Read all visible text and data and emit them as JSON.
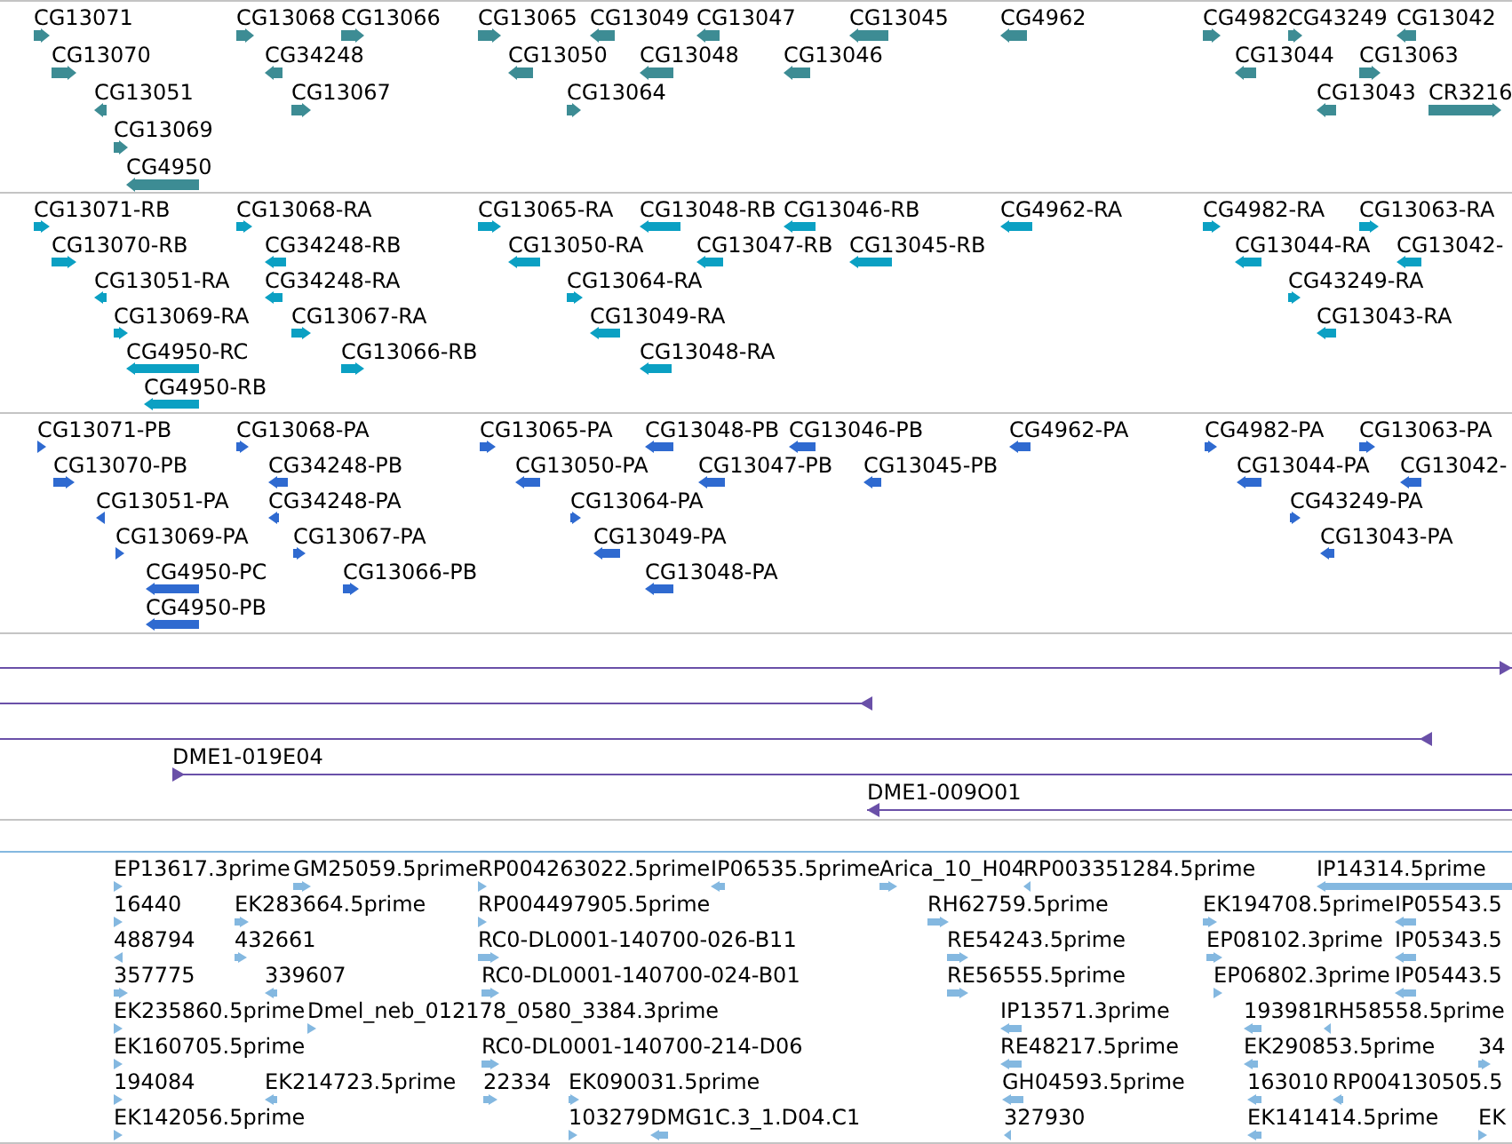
{
  "tracks": [
    {
      "kind": "gene",
      "features": [
        {
          "label": "CG13071",
          "reverse": false
        },
        {
          "label": "CG13068",
          "reverse": false
        },
        {
          "label": "CG13066",
          "reverse": false
        },
        {
          "label": "CG13065",
          "reverse": false
        },
        {
          "label": "CG13049",
          "reverse": true
        },
        {
          "label": "CG13047",
          "reverse": true
        },
        {
          "label": "CG13045",
          "reverse": true
        },
        {
          "label": "CG4962",
          "reverse": true
        },
        {
          "label": "CG4982",
          "reverse": false
        },
        {
          "label": "CG43249",
          "reverse": false
        },
        {
          "label": "CG13042",
          "reverse": true
        },
        {
          "label": "CG13070",
          "reverse": false
        },
        {
          "label": "CG34248",
          "reverse": true
        },
        {
          "label": "CG13050",
          "reverse": true
        },
        {
          "label": "CG13048",
          "reverse": true
        },
        {
          "label": "CG13046",
          "reverse": true
        },
        {
          "label": "CG13044",
          "reverse": true
        },
        {
          "label": "CG13063",
          "reverse": false
        },
        {
          "label": "CG13051",
          "reverse": true
        },
        {
          "label": "CG13067",
          "reverse": false
        },
        {
          "label": "CG13064",
          "reverse": false
        },
        {
          "label": "CG13043",
          "reverse": true
        },
        {
          "label": "CR3216",
          "reverse": false
        },
        {
          "label": "CG13069",
          "reverse": false
        },
        {
          "label": "CG4950",
          "reverse": true
        }
      ]
    },
    {
      "kind": "transcript",
      "features": [
        {
          "label": "CG13071-RB",
          "reverse": false
        },
        {
          "label": "CG13068-RA",
          "reverse": false
        },
        {
          "label": "CG13065-RA",
          "reverse": false
        },
        {
          "label": "CG13048-RB",
          "reverse": true
        },
        {
          "label": "CG13046-RB",
          "reverse": true
        },
        {
          "label": "CG4962-RA",
          "reverse": true
        },
        {
          "label": "CG4982-RA",
          "reverse": false
        },
        {
          "label": "CG13063-RA",
          "reverse": false
        },
        {
          "label": "CG13070-RB",
          "reverse": false
        },
        {
          "label": "CG34248-RB",
          "reverse": true
        },
        {
          "label": "CG13050-RA",
          "reverse": true
        },
        {
          "label": "CG13047-RB",
          "reverse": true
        },
        {
          "label": "CG13045-RB",
          "reverse": true
        },
        {
          "label": "CG13044-RA",
          "reverse": true
        },
        {
          "label": "CG13042-",
          "reverse": true
        },
        {
          "label": "CG13051-RA",
          "reverse": true
        },
        {
          "label": "CG34248-RA",
          "reverse": true
        },
        {
          "label": "CG13064-RA",
          "reverse": false
        },
        {
          "label": "CG43249-RA",
          "reverse": false
        },
        {
          "label": "CG13069-RA",
          "reverse": false
        },
        {
          "label": "CG13067-RA",
          "reverse": false
        },
        {
          "label": "CG13049-RA",
          "reverse": true
        },
        {
          "label": "CG13043-RA",
          "reverse": true
        },
        {
          "label": "CG4950-RC",
          "reverse": true
        },
        {
          "label": "CG13066-RB",
          "reverse": false
        },
        {
          "label": "CG13048-RA",
          "reverse": true
        },
        {
          "label": "CG4950-RB",
          "reverse": true
        }
      ]
    },
    {
      "kind": "protein",
      "features": [
        {
          "label": "CG13071-PB",
          "reverse": false
        },
        {
          "label": "CG13068-PA",
          "reverse": false
        },
        {
          "label": "CG13065-PA",
          "reverse": false
        },
        {
          "label": "CG13048-PB",
          "reverse": true
        },
        {
          "label": "CG13046-PB",
          "reverse": true
        },
        {
          "label": "CG4962-PA",
          "reverse": true
        },
        {
          "label": "CG4982-PA",
          "reverse": false
        },
        {
          "label": "CG13063-PA",
          "reverse": false
        },
        {
          "label": "CG13070-PB",
          "reverse": false
        },
        {
          "label": "CG34248-PB",
          "reverse": true
        },
        {
          "label": "CG13050-PA",
          "reverse": true
        },
        {
          "label": "CG13047-PB",
          "reverse": true
        },
        {
          "label": "CG13045-PB",
          "reverse": true
        },
        {
          "label": "CG13044-PA",
          "reverse": true
        },
        {
          "label": "CG13042-",
          "reverse": true
        },
        {
          "label": "CG13051-PA",
          "reverse": true
        },
        {
          "label": "CG34248-PA",
          "reverse": true
        },
        {
          "label": "CG13064-PA",
          "reverse": false
        },
        {
          "label": "CG43249-PA",
          "reverse": false
        },
        {
          "label": "CG13069-PA",
          "reverse": false
        },
        {
          "label": "CG13067-PA",
          "reverse": false
        },
        {
          "label": "CG13049-PA",
          "reverse": true
        },
        {
          "label": "CG13043-PA",
          "reverse": true
        },
        {
          "label": "CG4950-PC",
          "reverse": true
        },
        {
          "label": "CG13066-PB",
          "reverse": false
        },
        {
          "label": "CG13048-PA",
          "reverse": true
        },
        {
          "label": "CG4950-PB",
          "reverse": true
        }
      ]
    },
    {
      "kind": "clone",
      "features": [
        {
          "reverse": false
        },
        {
          "reverse": true
        },
        {
          "reverse": true
        },
        {
          "label": "DME1-019E04",
          "reverse": false
        },
        {
          "label": "DME1-009O01",
          "reverse": true
        }
      ]
    },
    {
      "kind": "est",
      "features": [
        {
          "label": "EP13617.3prime",
          "reverse": false
        },
        {
          "label": "GM25059.5prime",
          "reverse": false
        },
        {
          "label": "RP004263022.5prime",
          "reverse": false
        },
        {
          "label": "IP06535.5prime",
          "reverse": true
        },
        {
          "label": "Arica_10_H04",
          "reverse": false
        },
        {
          "label": "RP003351284.5prime",
          "reverse": true
        },
        {
          "label": "IP14314.5prime",
          "reverse": true
        },
        {
          "label": "16440",
          "reverse": false
        },
        {
          "label": "EK283664.5prime",
          "reverse": false
        },
        {
          "label": "RP004497905.5prime",
          "reverse": false
        },
        {
          "label": "RH62759.5prime",
          "reverse": false
        },
        {
          "label": "EK194708.5prime",
          "reverse": false
        },
        {
          "label": "IP05543.5",
          "reverse": true
        },
        {
          "label": "488794",
          "reverse": true
        },
        {
          "label": "432661",
          "reverse": false
        },
        {
          "label": "RC0-DL0001-140700-026-B11",
          "reverse": false
        },
        {
          "label": "RE54243.5prime",
          "reverse": false
        },
        {
          "label": "EP08102.3prime",
          "reverse": false
        },
        {
          "label": "IP05343.5",
          "reverse": true
        },
        {
          "label": "357775",
          "reverse": false
        },
        {
          "label": "339607",
          "reverse": true
        },
        {
          "label": "RC0-DL0001-140700-024-B01",
          "reverse": false
        },
        {
          "label": "RE56555.5prime",
          "reverse": false
        },
        {
          "label": "EP06802.3prime",
          "reverse": false
        },
        {
          "label": "IP05443.5",
          "reverse": true
        },
        {
          "label": "EK235860.5prime",
          "reverse": false
        },
        {
          "label": "Dmel_neb_012178_0580_3384.3prime",
          "reverse": false
        },
        {
          "label": "IP13571.3prime",
          "reverse": true
        },
        {
          "label": "193981",
          "reverse": true
        },
        {
          "label": "RH58558.5prime",
          "reverse": true
        },
        {
          "label": "EK160705.5prime",
          "reverse": false
        },
        {
          "label": "RC0-DL0001-140700-214-D06",
          "reverse": false
        },
        {
          "label": "RE48217.5prime",
          "reverse": true
        },
        {
          "label": "EK290853.5prime",
          "reverse": true
        },
        {
          "label": "34",
          "reverse": false
        },
        {
          "label": "194084",
          "reverse": false
        },
        {
          "label": "EK214723.5prime",
          "reverse": true
        },
        {
          "label": "22334",
          "reverse": false
        },
        {
          "label": "EK090031.5prime",
          "reverse": false
        },
        {
          "label": "GH04593.5prime",
          "reverse": true
        },
        {
          "label": "163010",
          "reverse": true
        },
        {
          "label": "RP004130505.5",
          "reverse": true
        },
        {
          "label": "EK142056.5prime",
          "reverse": false
        },
        {
          "label": "103279",
          "reverse": false
        },
        {
          "label": "DMG1C.3_1.D04.C1",
          "reverse": true
        },
        {
          "label": "327930",
          "reverse": true
        },
        {
          "label": "EK141414.5prime",
          "reverse": true
        },
        {
          "label": "EK",
          "reverse": false
        }
      ]
    }
  ]
}
